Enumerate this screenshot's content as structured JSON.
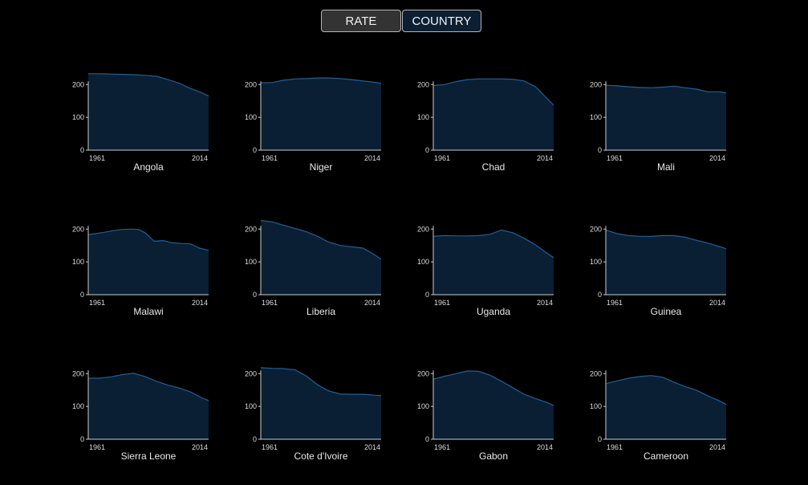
{
  "toggle": {
    "rate_label": "RATE",
    "country_label": "COUNTRY"
  },
  "colors": {
    "background": "#000000",
    "area_fill": "#0a1f33",
    "area_stroke": "#1f5f9a",
    "axis": "#cccccc",
    "text": "#dcdcdc"
  },
  "chart_data": {
    "type": "area",
    "x_start_label": "1961",
    "x_end_label": "2014",
    "x_range": [
      1961,
      2014
    ],
    "ylim": [
      0,
      230
    ],
    "yticks": [
      0,
      100,
      200
    ],
    "title": "",
    "xlabel": "",
    "ylabel": "",
    "charts": [
      {
        "country": "Angola",
        "x": [
          1961,
          1966,
          1971,
          1976,
          1981,
          1986,
          1991,
          1996,
          2001,
          2006,
          2011,
          2014
        ],
        "values": [
          233,
          233,
          232,
          231,
          230,
          228,
          225,
          215,
          204,
          188,
          175,
          165
        ]
      },
      {
        "country": "Niger",
        "x": [
          1961,
          1966,
          1971,
          1976,
          1981,
          1986,
          1991,
          1996,
          2001,
          2006,
          2011,
          2014
        ],
        "values": [
          205,
          206,
          213,
          217,
          218,
          220,
          220,
          218,
          215,
          211,
          207,
          203
        ]
      },
      {
        "country": "Chad",
        "x": [
          1961,
          1966,
          1971,
          1976,
          1981,
          1986,
          1991,
          1996,
          2001,
          2006,
          2011,
          2014
        ],
        "values": [
          197,
          200,
          209,
          215,
          217,
          217,
          217,
          216,
          211,
          193,
          158,
          137
        ]
      },
      {
        "country": "Mali",
        "x": [
          1961,
          1966,
          1971,
          1976,
          1981,
          1986,
          1991,
          1996,
          2001,
          2006,
          2011,
          2014
        ],
        "values": [
          198,
          196,
          193,
          191,
          190,
          192,
          195,
          190,
          186,
          178,
          178,
          175
        ]
      },
      {
        "country": "Malawi",
        "x": [
          1961,
          1964,
          1968,
          1972,
          1976,
          1980,
          1983,
          1986,
          1990,
          1994,
          1998,
          2002,
          2006,
          2010,
          2014
        ],
        "values": [
          183,
          186,
          190,
          195,
          199,
          200,
          199,
          189,
          163,
          165,
          158,
          156,
          155,
          142,
          135
        ]
      },
      {
        "country": "Liberia",
        "x": [
          1961,
          1966,
          1971,
          1976,
          1981,
          1986,
          1991,
          1996,
          2001,
          2006,
          2011,
          2014
        ],
        "values": [
          226,
          222,
          212,
          202,
          192,
          178,
          160,
          150,
          146,
          142,
          122,
          108
        ]
      },
      {
        "country": "Uganda",
        "x": [
          1961,
          1966,
          1971,
          1976,
          1981,
          1986,
          1991,
          1996,
          2001,
          2006,
          2011,
          2014
        ],
        "values": [
          178,
          180,
          179,
          179,
          180,
          184,
          197,
          189,
          172,
          152,
          127,
          113
        ]
      },
      {
        "country": "Guinea",
        "x": [
          1961,
          1966,
          1971,
          1976,
          1981,
          1986,
          1991,
          1996,
          2001,
          2006,
          2011,
          2014
        ],
        "values": [
          197,
          186,
          180,
          178,
          178,
          180,
          180,
          175,
          166,
          157,
          147,
          140
        ]
      },
      {
        "country": "Sierra Leone",
        "x": [
          1961,
          1966,
          1971,
          1976,
          1981,
          1986,
          1991,
          1996,
          2001,
          2006,
          2011,
          2014
        ],
        "values": [
          186,
          186,
          190,
          197,
          201,
          191,
          177,
          165,
          156,
          144,
          126,
          118
        ]
      },
      {
        "country": "Cote d'Ivoire",
        "x": [
          1961,
          1966,
          1971,
          1976,
          1981,
          1986,
          1991,
          1996,
          2001,
          2006,
          2011,
          2014
        ],
        "values": [
          218,
          216,
          215,
          212,
          193,
          166,
          147,
          138,
          137,
          137,
          134,
          133
        ]
      },
      {
        "country": "Gabon",
        "x": [
          1961,
          1966,
          1971,
          1976,
          1981,
          1986,
          1991,
          1996,
          2001,
          2006,
          2011,
          2014
        ],
        "values": [
          183,
          192,
          200,
          208,
          207,
          195,
          177,
          157,
          137,
          124,
          112,
          103
        ]
      },
      {
        "country": "Cameroon",
        "x": [
          1961,
          1966,
          1971,
          1976,
          1981,
          1986,
          1991,
          1996,
          2001,
          2006,
          2011,
          2014
        ],
        "values": [
          169,
          178,
          186,
          191,
          194,
          189,
          174,
          160,
          149,
          132,
          117,
          106
        ]
      }
    ]
  }
}
